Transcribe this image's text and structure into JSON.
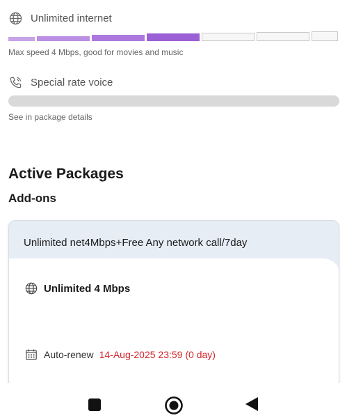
{
  "internet": {
    "icon": "globe-icon",
    "label": "Unlimited internet",
    "description": "Max speed 4 Mbps, good for movies and music",
    "level_filled_segments": 4,
    "level_total_segments": 7,
    "accent_color": "#9b5fd6"
  },
  "voice": {
    "icon": "phone-icon",
    "label": "Special rate voice",
    "description": "See in package details",
    "bar_color": "#d9d9d9"
  },
  "sections": {
    "active_packages": "Active Packages",
    "addons": "Add-ons"
  },
  "addon_card": {
    "title": "Unlimited net4Mbps+Free Any network call/7day",
    "package_name": "Unlimited 4 Mbps",
    "package_icon": "globe-icon",
    "renew_label": "Auto-renew",
    "renew_date": "14-Aug-2025 23:59 (0 day)",
    "renew_icon": "calendar-icon",
    "renew_color": "#d0262b"
  },
  "nav": {
    "buttons": [
      "recents-button",
      "home-button",
      "back-button"
    ]
  }
}
